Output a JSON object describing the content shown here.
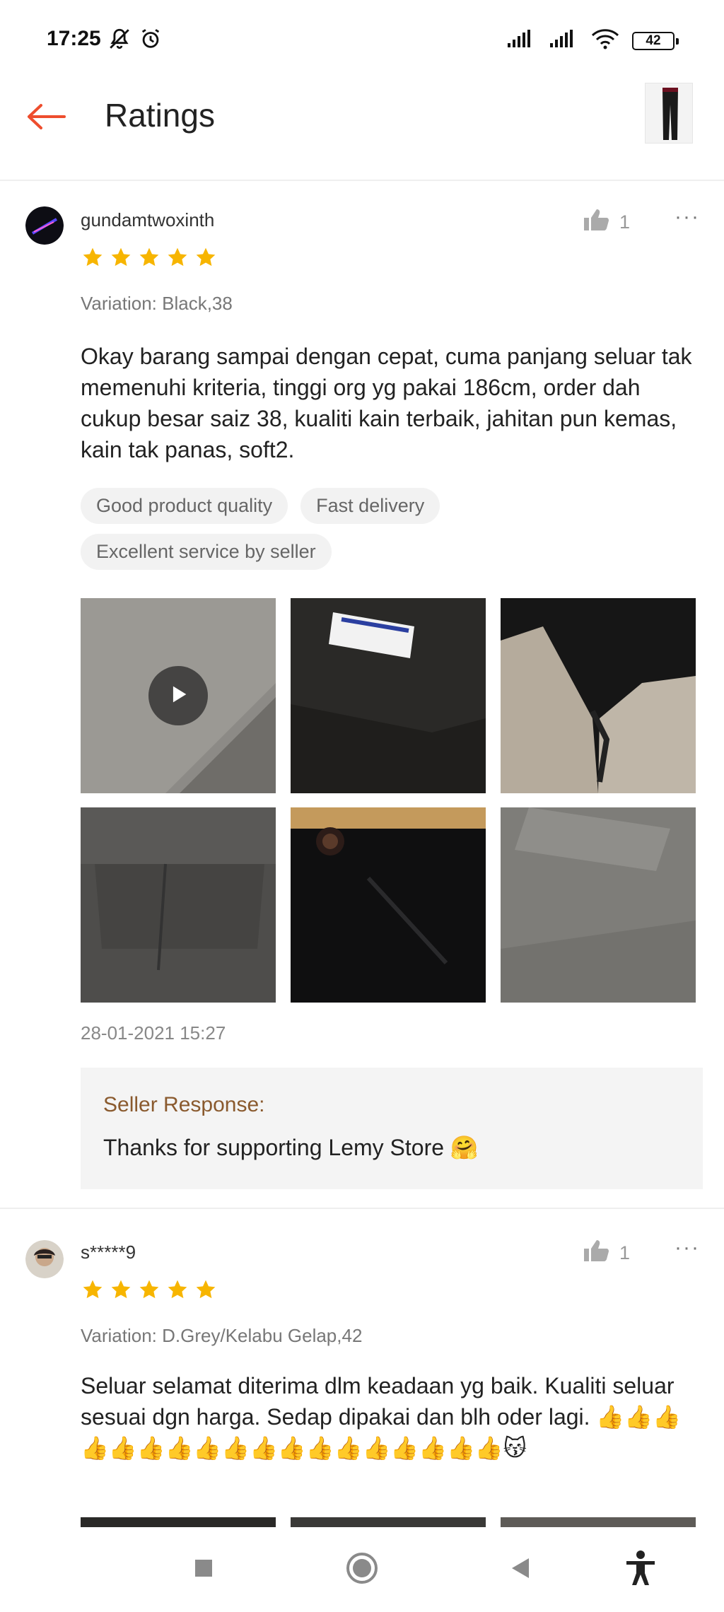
{
  "status_bar": {
    "time": "17:25",
    "battery": "42"
  },
  "header": {
    "title": "Ratings",
    "accent_color": "#ee4d2d"
  },
  "reviews": [
    {
      "username": "gundamtwoxinth",
      "likes": "1",
      "rating": 5,
      "variation": "Variation: Black,38",
      "text": "Okay barang sampai dengan cepat, cuma panjang seluar tak memenuhi kriteria, tinggi org yg pakai 186cm, order dah cukup besar saiz 38, kualiti kain terbaik, jahitan pun kemas, kain tak panas, soft2.",
      "tags": [
        "Good product quality",
        "Fast delivery",
        "Excellent service by seller"
      ],
      "timestamp": "28-01-2021 15:27",
      "seller_response_label": "Seller Response:",
      "seller_response_text": "Thanks for supporting Lemy Store 🤗"
    },
    {
      "username": "s*****9",
      "likes": "1",
      "rating": 5,
      "variation": "Variation: D.Grey/Kelabu Gelap,42",
      "text": "Seluar selamat diterima dlm keadaan yg baik. Kualiti seluar sesuai dgn harga. Sedap dipakai dan blh oder lagi. 👍👍👍👍👍👍👍👍👍👍👍👍👍👍👍👍👍👍😽"
    }
  ],
  "colors": {
    "star": "#f7b500",
    "seller_label": "#8a5a2e"
  }
}
